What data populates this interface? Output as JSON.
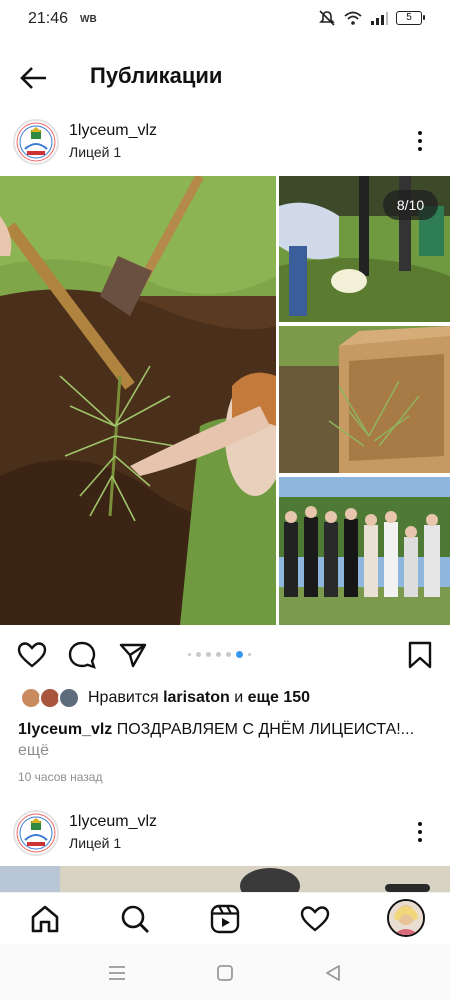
{
  "status_bar": {
    "time": "21:46",
    "carrier_badge": "WB",
    "battery": "5",
    "icons": [
      "mute-icon",
      "wifi-icon",
      "signal-icon",
      "battery-icon"
    ]
  },
  "header": {
    "title": "Публикации",
    "back_icon": "arrow-left-icon"
  },
  "posts": [
    {
      "username": "1lyceum_vlz",
      "location": "Лицей 1",
      "carousel_counter": "8/10",
      "carousel_total": 10,
      "carousel_current": 8,
      "likes": {
        "prefix": "Нравится",
        "user": "larisaton",
        "connector": "и",
        "others": "еще 150"
      },
      "caption_user": "1lyceum_vlz",
      "caption_text": "ПОЗДРАВЛЯЕМ С ДНЁМ ЛИЦЕИСТА!...",
      "more_label": "ещё",
      "time_ago": "10 часов назад"
    },
    {
      "username": "1lyceum_vlz",
      "location": "Лицей 1"
    }
  ],
  "bottom_nav": {
    "items": [
      "home-icon",
      "search-icon",
      "reels-icon",
      "heart-icon",
      "profile-avatar"
    ]
  },
  "system_nav": {
    "items": [
      "menu-icon",
      "home-square-icon",
      "back-triangle-icon"
    ]
  },
  "colors": {
    "accent_blue": "#3897f0",
    "muted_text": "#8e8e8e"
  }
}
